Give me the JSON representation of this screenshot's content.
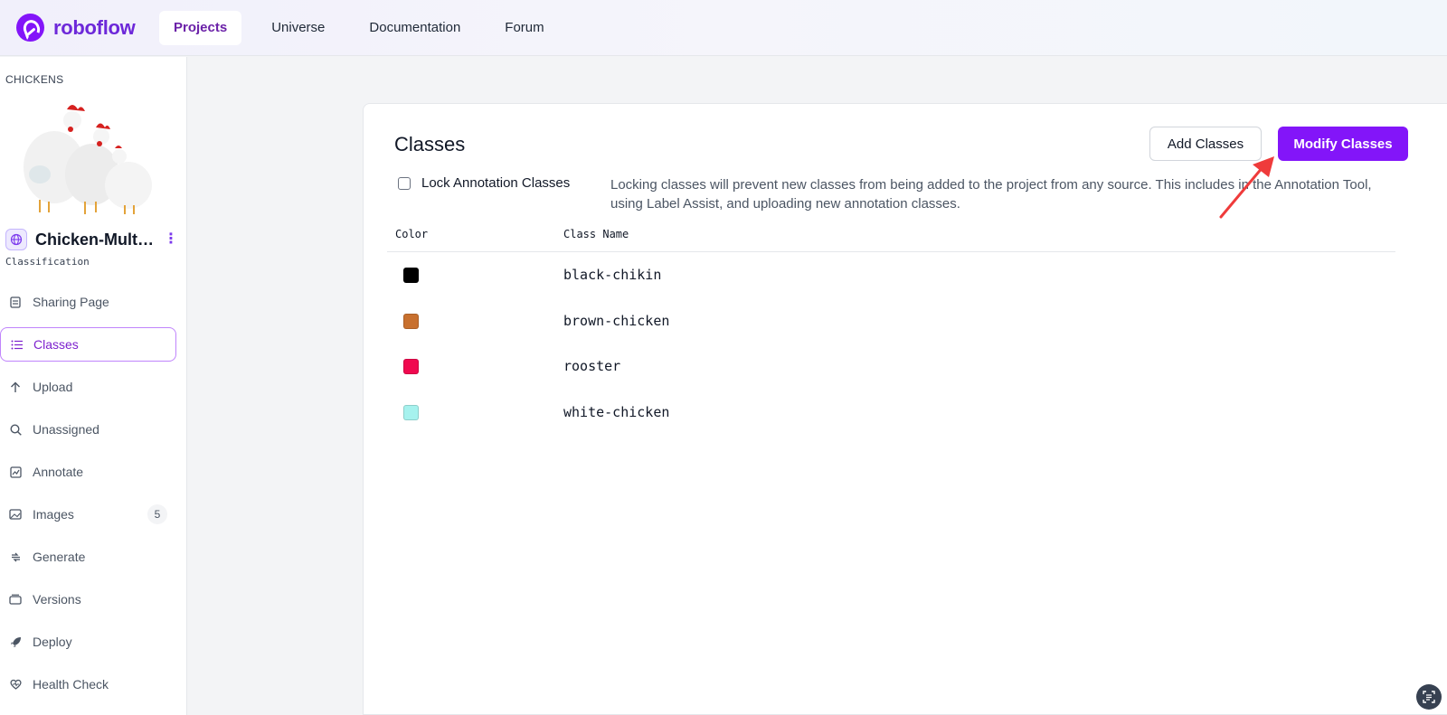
{
  "brand": {
    "name": "roboflow",
    "color": "#8315f9"
  },
  "topnav": {
    "items": [
      {
        "label": "Projects",
        "active": true
      },
      {
        "label": "Universe",
        "active": false
      },
      {
        "label": "Documentation",
        "active": false
      },
      {
        "label": "Forum",
        "active": false
      }
    ]
  },
  "sidebar": {
    "group": "CHICKENS",
    "project_name": "Chicken-Multi...",
    "project_type": "Classification",
    "items": [
      {
        "label": "Sharing Page",
        "icon": "document-icon",
        "active": false
      },
      {
        "label": "Classes",
        "icon": "list-icon",
        "active": true
      },
      {
        "label": "Upload",
        "icon": "arrow-up-icon",
        "active": false
      },
      {
        "label": "Unassigned",
        "icon": "search-icon",
        "active": false
      },
      {
        "label": "Annotate",
        "icon": "annotate-icon",
        "active": false
      },
      {
        "label": "Images",
        "icon": "images-icon",
        "active": false,
        "badge": "5"
      },
      {
        "label": "Generate",
        "icon": "generate-icon",
        "active": false
      },
      {
        "label": "Versions",
        "icon": "versions-icon",
        "active": false
      },
      {
        "label": "Deploy",
        "icon": "rocket-icon",
        "active": false
      },
      {
        "label": "Health Check",
        "icon": "heart-icon",
        "active": false
      }
    ]
  },
  "main": {
    "title": "Classes",
    "add_button": "Add Classes",
    "modify_button": "Modify Classes",
    "lock_label": "Lock Annotation Classes",
    "lock_checked": false,
    "lock_description": "Locking classes will prevent new classes from being added to the project from any source. This includes in the Annotation Tool, using Label Assist, and uploading new annotation classes.",
    "columns": [
      "Color",
      "Class Name"
    ],
    "classes": [
      {
        "name": "black-chikin",
        "color": "#000000"
      },
      {
        "name": "brown-chicken",
        "color": "#c8702e"
      },
      {
        "name": "rooster",
        "color": "#f0094f"
      },
      {
        "name": "white-chicken",
        "color": "#a6f2ee"
      }
    ]
  }
}
